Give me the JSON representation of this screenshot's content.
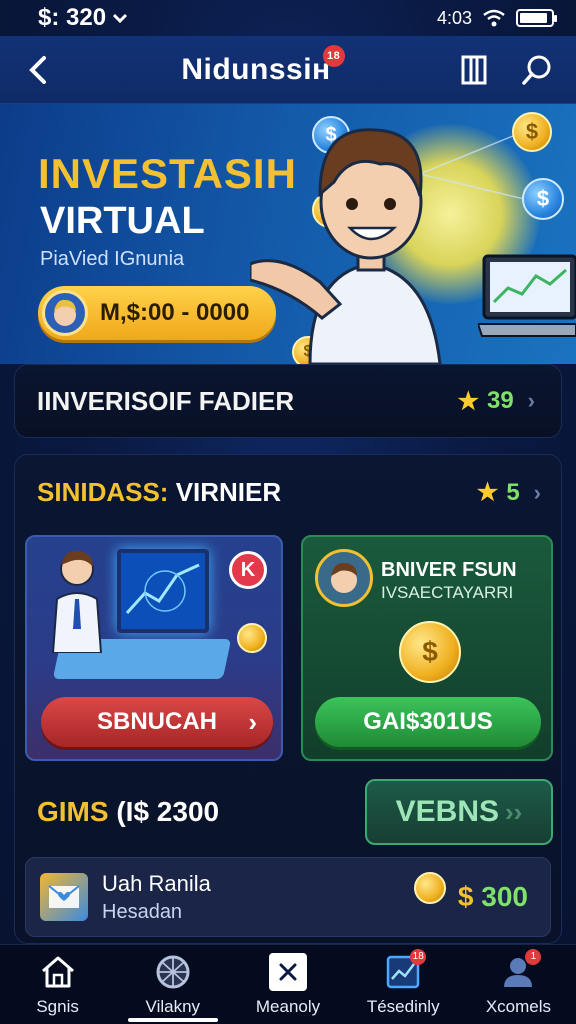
{
  "status_bar": {
    "balance": "$: 320",
    "time": "4:03"
  },
  "app_bar": {
    "title": "Nidunssiн",
    "title_badge": "18"
  },
  "hero": {
    "title": "INVESTASIH",
    "subtitle": "VIRTUAL",
    "tagline": "PiaVied IGnunia",
    "pill_value": "M,$:00 - 0000",
    "coins": [
      "$",
      "$",
      "$",
      "$",
      "$"
    ]
  },
  "featured_row": {
    "title": "IINVERISOIF FADIER",
    "rating": "39"
  },
  "section": {
    "title_gold": "SINIDASS:",
    "title_white": " VIRNIER",
    "rating": "5",
    "left_card": {
      "badge": "K",
      "button_label": "SBNUCAH"
    },
    "right_card": {
      "title": "BNIVER FSUN",
      "subtitle": "IVSAECTAYARRI",
      "coin_symbol": "$",
      "button_label": "GAI$301US"
    },
    "gems": {
      "label_gold": "GIMS",
      "label_white": " (I$ 2300",
      "button_label": "VEBNS"
    },
    "list_item": {
      "title": "Uah Ranila",
      "subtitle": "Hesadan",
      "amount_symbol": "$",
      "amount": " 300"
    }
  },
  "bottom_nav": [
    {
      "label": "Sgnis",
      "icon": "home-icon"
    },
    {
      "label": "Vilakny",
      "icon": "globe-icon"
    },
    {
      "label": "Meanoly",
      "icon": "close-icon"
    },
    {
      "label": "Tésedinly",
      "icon": "chart-icon",
      "badge": "18"
    },
    {
      "label": "Xcomels",
      "icon": "profile-icon",
      "badge": "1"
    }
  ],
  "colors": {
    "accent_gold": "#f2c030",
    "accent_green": "#7fe06a",
    "background": "#0a1a44"
  }
}
